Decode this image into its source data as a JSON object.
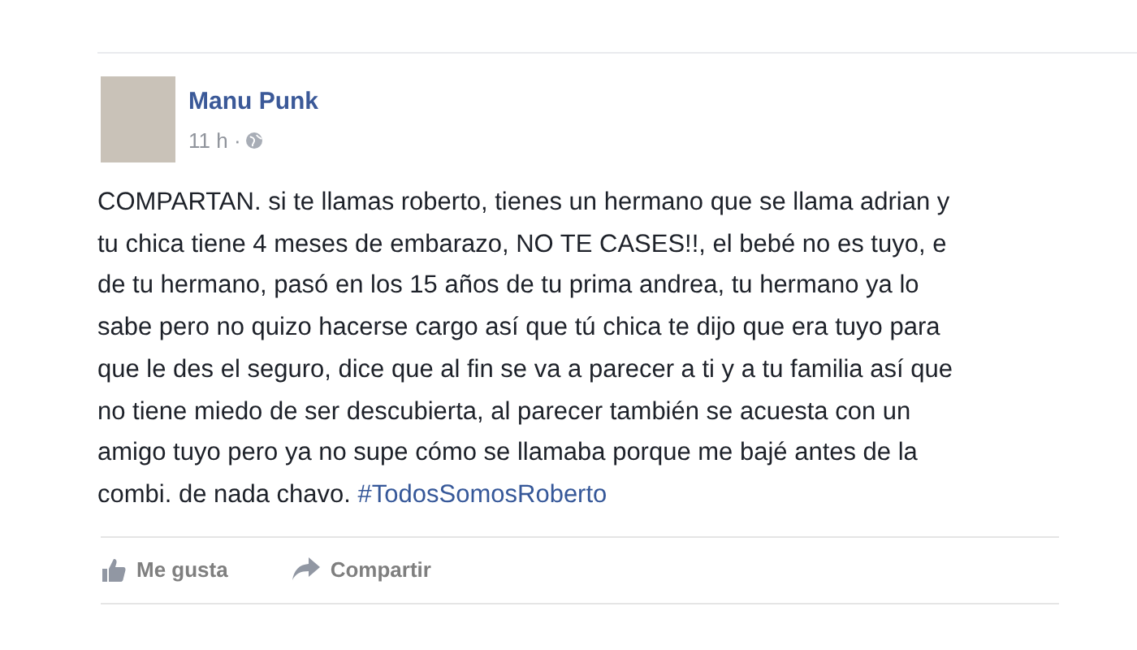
{
  "post": {
    "author": "Manu Punk",
    "time": "11 h ·",
    "lines": [
      "COMPARTAN. si te llamas roberto, tienes un hermano que se llama adrian y",
      "tu chica tiene 4 meses de embarazo, NO TE CASES!!, el bebé no es tuyo, e",
      "de tu hermano, pasó en los 15 años de tu prima andrea, tu hermano ya lo",
      "sabe pero no quizo hacerse cargo así que tú chica te dijo que era tuyo para",
      "que le des el seguro, dice que al fin se va a parecer a ti y a tu familia así que",
      "no tiene miedo de ser descubierta, al parecer también se acuesta con un",
      "amigo tuyo pero ya no supe cómo se llamaba porque me bajé antes de la",
      "combi. de nada chavo."
    ],
    "hashtag": "#TodosSomosRoberto",
    "actions": [
      {
        "kind": "like",
        "label": "Me gusta"
      },
      {
        "kind": "share",
        "label": "Compartir"
      }
    ]
  }
}
